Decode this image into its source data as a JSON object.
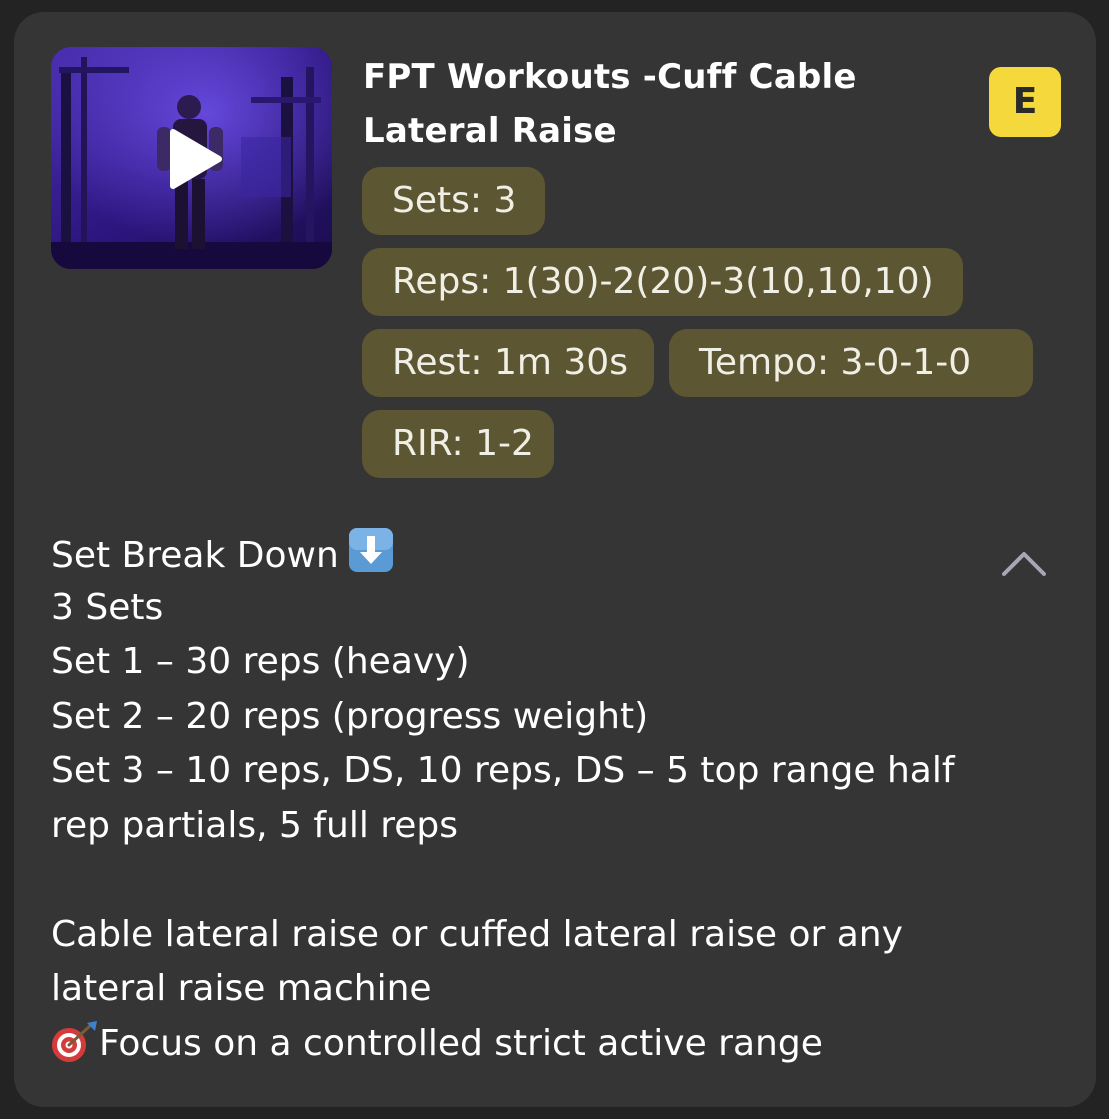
{
  "exercise": {
    "title": "FPT Workouts -Cuff Cable Lateral Raise",
    "badge": "E",
    "badge_color": "#f5d93c",
    "pill_color": "#5d5632",
    "video_thumbnail_icon": "play-icon",
    "pills": {
      "sets": "Sets: 3",
      "reps": "Reps: 1(30)-2(20)-3(10,10,10)",
      "rest": "Rest: 1m 30s",
      "tempo": "Tempo: 3-0-1-0",
      "rir": "RIR: 1-2"
    }
  },
  "description": {
    "heading": "Set Break Down",
    "heading_icon": "down-arrow-emoji",
    "lines": [
      "3 Sets",
      "Set 1 – 30 reps (heavy)",
      "Set 2 – 20 reps (progress weight)",
      "Set 3 – 10 reps, DS, 10 reps, DS – 5 top range half rep partials, 5 full reps"
    ],
    "paragraph": "Cable lateral raise or cuffed lateral  raise or any lateral raise machine",
    "focus": "Focus on a controlled strict active range",
    "focus_icon": "dart-target-emoji",
    "collapse_icon": "chevron-up-icon"
  }
}
